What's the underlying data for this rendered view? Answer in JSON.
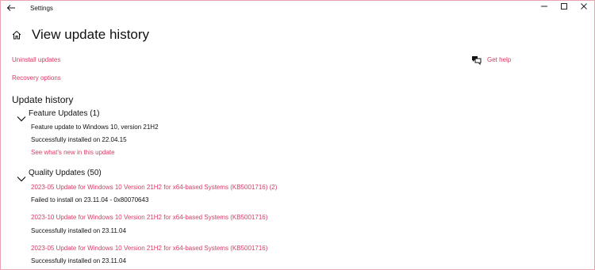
{
  "window": {
    "title": "Settings",
    "back_icon": "back-arrow-icon"
  },
  "header": {
    "title": "View update history"
  },
  "links": {
    "uninstall": "Uninstall updates",
    "recovery": "Recovery options",
    "get_help": "Get help"
  },
  "history": {
    "title": "Update history",
    "feature": {
      "title": "Feature Updates (1)",
      "items": [
        {
          "name": "Feature update to Windows 10, version 21H2",
          "status": "Successfully installed on 22.04.15",
          "link": "See what's new in this update"
        }
      ]
    },
    "quality": {
      "title": "Quality Updates (50)",
      "items": [
        {
          "name": "2023-05 Update for Windows 10 Version 21H2 for x64-based Systems (KB5001716) (2)",
          "status": "Failed to install on 23.11.04 - 0x80070643"
        },
        {
          "name": "2023-10 Update for Windows 10 Version 21H2 for x64-based Systems (KB5001716)",
          "status": "Successfully installed on 23.11.04"
        },
        {
          "name": "2023-05 Update for Windows 10 Version 21H2 for x64-based Systems (KB5001716)",
          "status": "Successfully installed on 23.11.04"
        }
      ]
    }
  },
  "colors": {
    "accent": "#d83b63",
    "border": "#e8a2b2",
    "text": "#111111"
  }
}
